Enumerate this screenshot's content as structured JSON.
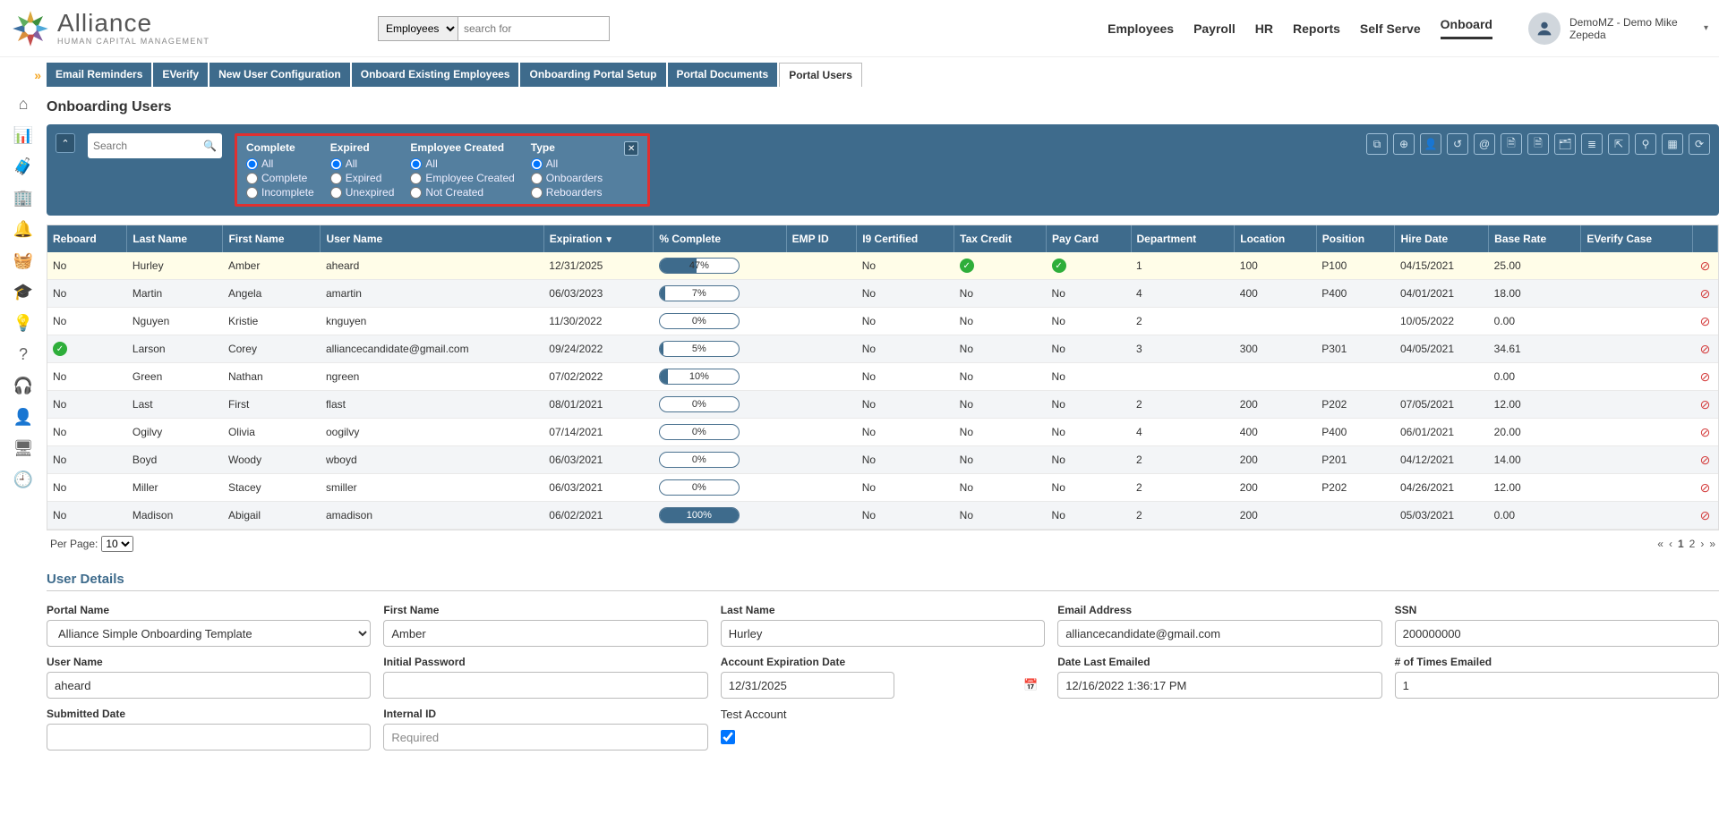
{
  "brand": {
    "name": "Alliance",
    "sub": "HUMAN CAPITAL MANAGEMENT"
  },
  "topSearch": {
    "scope": "Employees",
    "placeholder": "search for"
  },
  "mainNav": [
    "Employees",
    "Payroll",
    "HR",
    "Reports",
    "Self Serve",
    "Onboard"
  ],
  "mainNavActive": "Onboard",
  "user": {
    "display": "DemoMZ - Demo Mike Zepeda"
  },
  "subtabs": [
    "Email Reminders",
    "EVerify",
    "New User Configuration",
    "Onboard Existing Employees",
    "Onboarding Portal Setup",
    "Portal Documents",
    "Portal Users"
  ],
  "subtabActive": "Portal Users",
  "pageTitle": "Onboarding Users",
  "filterSearchPlaceholder": "Search",
  "filterGroups": [
    {
      "title": "Complete",
      "options": [
        "All",
        "Complete",
        "Incomplete"
      ],
      "selected": "All"
    },
    {
      "title": "Expired",
      "options": [
        "All",
        "Expired",
        "Unexpired"
      ],
      "selected": "All"
    },
    {
      "title": "Employee Created",
      "options": [
        "All",
        "Employee Created",
        "Not Created"
      ],
      "selected": "All"
    },
    {
      "title": "Type",
      "options": [
        "All",
        "Onboarders",
        "Reboarders"
      ],
      "selected": "All"
    }
  ],
  "toolbarIcons": [
    "⧉",
    "⊕",
    "👤",
    "↺",
    "@",
    "🗎",
    "🗎",
    "🗂",
    "≣",
    "⇱",
    "⚲",
    "▦",
    "⟳"
  ],
  "columns": [
    "Reboard",
    "Last Name",
    "First Name",
    "User Name",
    "Expiration",
    "% Complete",
    "EMP ID",
    "I9 Certified",
    "Tax Credit",
    "Pay Card",
    "Department",
    "Location",
    "Position",
    "Hire Date",
    "Base Rate",
    "EVerify Case",
    ""
  ],
  "sortedCol": "Expiration",
  "rows": [
    {
      "selected": true,
      "reboard": "No",
      "last": "Hurley",
      "first": "Amber",
      "user": "aheard",
      "exp": "12/31/2025",
      "pct": 47,
      "emp": "",
      "i9": "No",
      "taxCheck": true,
      "payCheck": true,
      "dept": "1",
      "loc": "100",
      "pos": "P100",
      "hire": "04/15/2021",
      "rate": "25.00",
      "everify": ""
    },
    {
      "reboard": "No",
      "last": "Martin",
      "first": "Angela",
      "user": "amartin",
      "exp": "06/03/2023",
      "pct": 7,
      "emp": "",
      "i9": "No",
      "tax": "No",
      "pay": "No",
      "dept": "4",
      "loc": "400",
      "pos": "P400",
      "hire": "04/01/2021",
      "rate": "18.00",
      "everify": ""
    },
    {
      "reboard": "No",
      "last": "Nguyen",
      "first": "Kristie",
      "user": "knguyen",
      "exp": "11/30/2022",
      "pct": 0,
      "emp": "",
      "i9": "No",
      "tax": "No",
      "pay": "No",
      "dept": "2",
      "loc": "",
      "pos": "",
      "hire": "10/05/2022",
      "rate": "0.00",
      "everify": ""
    },
    {
      "reboardCheck": true,
      "last": "Larson",
      "first": "Corey",
      "user": "alliancecandidate@gmail.com",
      "exp": "09/24/2022",
      "pct": 5,
      "emp": "",
      "i9": "No",
      "tax": "No",
      "pay": "No",
      "dept": "3",
      "loc": "300",
      "pos": "P301",
      "hire": "04/05/2021",
      "rate": "34.61",
      "everify": ""
    },
    {
      "reboard": "No",
      "last": "Green",
      "first": "Nathan",
      "user": "ngreen",
      "exp": "07/02/2022",
      "pct": 10,
      "emp": "",
      "i9": "No",
      "tax": "No",
      "pay": "No",
      "dept": "",
      "loc": "",
      "pos": "",
      "hire": "",
      "rate": "0.00",
      "everify": ""
    },
    {
      "reboard": "No",
      "last": "Last",
      "first": "First",
      "user": "flast",
      "exp": "08/01/2021",
      "pct": 0,
      "emp": "",
      "i9": "No",
      "tax": "No",
      "pay": "No",
      "dept": "2",
      "loc": "200",
      "pos": "P202",
      "hire": "07/05/2021",
      "rate": "12.00",
      "everify": ""
    },
    {
      "reboard": "No",
      "last": "Ogilvy",
      "first": "Olivia",
      "user": "oogilvy",
      "exp": "07/14/2021",
      "pct": 0,
      "emp": "",
      "i9": "No",
      "tax": "No",
      "pay": "No",
      "dept": "4",
      "loc": "400",
      "pos": "P400",
      "hire": "06/01/2021",
      "rate": "20.00",
      "everify": ""
    },
    {
      "reboard": "No",
      "last": "Boyd",
      "first": "Woody",
      "user": "wboyd",
      "exp": "06/03/2021",
      "pct": 0,
      "emp": "",
      "i9": "No",
      "tax": "No",
      "pay": "No",
      "dept": "2",
      "loc": "200",
      "pos": "P201",
      "hire": "04/12/2021",
      "rate": "14.00",
      "everify": ""
    },
    {
      "reboard": "No",
      "last": "Miller",
      "first": "Stacey",
      "user": "smiller",
      "exp": "06/03/2021",
      "pct": 0,
      "emp": "",
      "i9": "No",
      "tax": "No",
      "pay": "No",
      "dept": "2",
      "loc": "200",
      "pos": "P202",
      "hire": "04/26/2021",
      "rate": "12.00",
      "everify": ""
    },
    {
      "reboard": "No",
      "last": "Madison",
      "first": "Abigail",
      "user": "amadison",
      "exp": "06/02/2021",
      "pct": 100,
      "emp": "",
      "i9": "No",
      "tax": "No",
      "pay": "No",
      "dept": "2",
      "loc": "200",
      "pos": "",
      "hire": "05/03/2021",
      "rate": "0.00",
      "everify": ""
    }
  ],
  "pager": {
    "perPageLabel": "Per Page:",
    "perPage": "10",
    "pages": [
      "1",
      "2"
    ],
    "current": "1"
  },
  "detailsTitle": "User Details",
  "details": {
    "portalNameLabel": "Portal Name",
    "portalName": "Alliance Simple Onboarding Template",
    "firstNameLabel": "First Name",
    "firstName": "Amber",
    "lastNameLabel": "Last Name",
    "lastName": "Hurley",
    "emailLabel": "Email Address",
    "email": "alliancecandidate@gmail.com",
    "ssnLabel": "SSN",
    "ssn": "200000000",
    "userNameLabel": "User Name",
    "userName": "aheard",
    "initialPasswordLabel": "Initial Password",
    "initialPassword": "",
    "acctExpLabel": "Account Expiration Date",
    "acctExp": "12/31/2025",
    "dateLastLabel": "Date Last Emailed",
    "dateLast": "12/16/2022 1:36:17 PM",
    "timesEmailedLabel": "# of Times Emailed",
    "timesEmailed": "1",
    "submittedLabel": "Submitted Date",
    "submitted": "",
    "internalIdLabel": "Internal ID",
    "internalIdPlaceholder": "Required",
    "testAccountLabel": "Test Account",
    "testAccount": true
  }
}
